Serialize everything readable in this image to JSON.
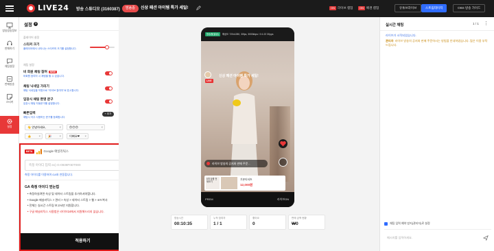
{
  "topbar": {
    "logo": "LIVE24",
    "studio": "방송 스튜디오 (3160387)",
    "status": "방송중",
    "title": "신상 패션 아이템 특가 세일!",
    "actions": [
      {
        "tag": "ON",
        "label": "라이브 랩업"
      },
      {
        "tag": "ON",
        "label": "배경 랩업"
      }
    ],
    "buttons": [
      "유튜브라이브",
      "스트림테이지",
      "OBS 방송 가이드"
    ]
  },
  "leftnav": {
    "items": [
      "방송방송정보",
      "판매하기",
      "채팅설정",
      "판매방송",
      "스티커",
      "설정"
    ]
  },
  "settings": {
    "title": "설정",
    "sections": {
      "player": "플레이어 설정",
      "chat": "채팅 설정"
    },
    "sticker_size": {
      "label": "스티커 크기",
      "desc": "플레이어에서 나타나는 스티커의 크기를 설정합니다.",
      "level": 0.7
    },
    "rows": [
      {
        "label": "비 회원 채팅 참여",
        "badge": "NEW",
        "desc": "비회원 참여자 시 채팅을 할 수 있습니다.",
        "on": true
      },
      {
        "label": "채팅 닉네임 가리기",
        "desc": "채팅 닉네임을 익명으로 \"라이브 참여자\"로 표시합니다.",
        "on": true
      },
      {
        "label": "입장시 채팅 환영 문구",
        "desc": "입장시 채팅 자동문구를 설정합니다.",
        "on": true
      }
    ],
    "quick": {
      "label": "빠른입력",
      "desc": "채팅시 자주 사용하는 문구를 등록합니다.",
      "add": "+ 추가"
    },
    "chips": [
      "👋 안녕하세요,",
      "😍😍😍",
      "👍 ",
      "🎉",
      "이뻐요❤"
    ]
  },
  "ga": {
    "beta": "BETA",
    "name": "Google 애널리틱스",
    "placeholder": "측정 아이디 입력 ex) G-0938F0DT000",
    "hint": "측정 아이디를 이용하여 GA와 연동합니다.",
    "guide_title": "GA 측정 아이디 얻는법",
    "steps": [
      "측정하실려면 속성 및 데이터 스트림을 추가하셔야합니다.",
      "Google 애널리틱스 > 관리 > 속성 > 데이터 스트림 > 웹 > 코드복사",
      "전체는 실시간 스트림 보고서만 지원합니다.",
      "구글 애널리틱스 사용법은 라이브24에서 지원해드리지 않습니다."
    ],
    "apply": "적용하기"
  },
  "phone": {
    "chip": "방송중(발송)",
    "spec": "해상도 720x1280, 30fps, 3000kbps / 0:1:22 30pps",
    "live": "LIVE",
    "title": "신상 패션 아이템 특가 세일!",
    "message": "라이브 방송의 공지와 판매 주문...",
    "product_thumb": "6개 상품 전체보기",
    "product_name": "기본티셔츠",
    "product_price": "12,000원",
    "bottom_left": "PREM",
    "bottom_right": "라이브ON"
  },
  "stats": [
    {
      "label": "방송시간",
      "value": "00:10:35"
    },
    {
      "label": "누적 참여자",
      "value": "1 / 1"
    },
    {
      "label": "좋아요",
      "value": "0"
    },
    {
      "label": "판매 금액 현황",
      "value": "₩0"
    }
  ],
  "chat": {
    "title": "실시간 채팅",
    "count": "1 / 1",
    "notice": "라이브가 시작되었습니다.",
    "sender": "관리자",
    "message": "라이브 방송의 공지와 판매 주문하시는 방법을 안내하였습니다. 많은 이용 부탁 드립니다.",
    "option": "채팅 입력 예약 방지(관리자)로 설정",
    "placeholder": "메시지를 입력하세요."
  },
  "colors": {
    "accent": "#e83838",
    "primary": "#2f6cff",
    "dark": "#1b1b1b"
  }
}
